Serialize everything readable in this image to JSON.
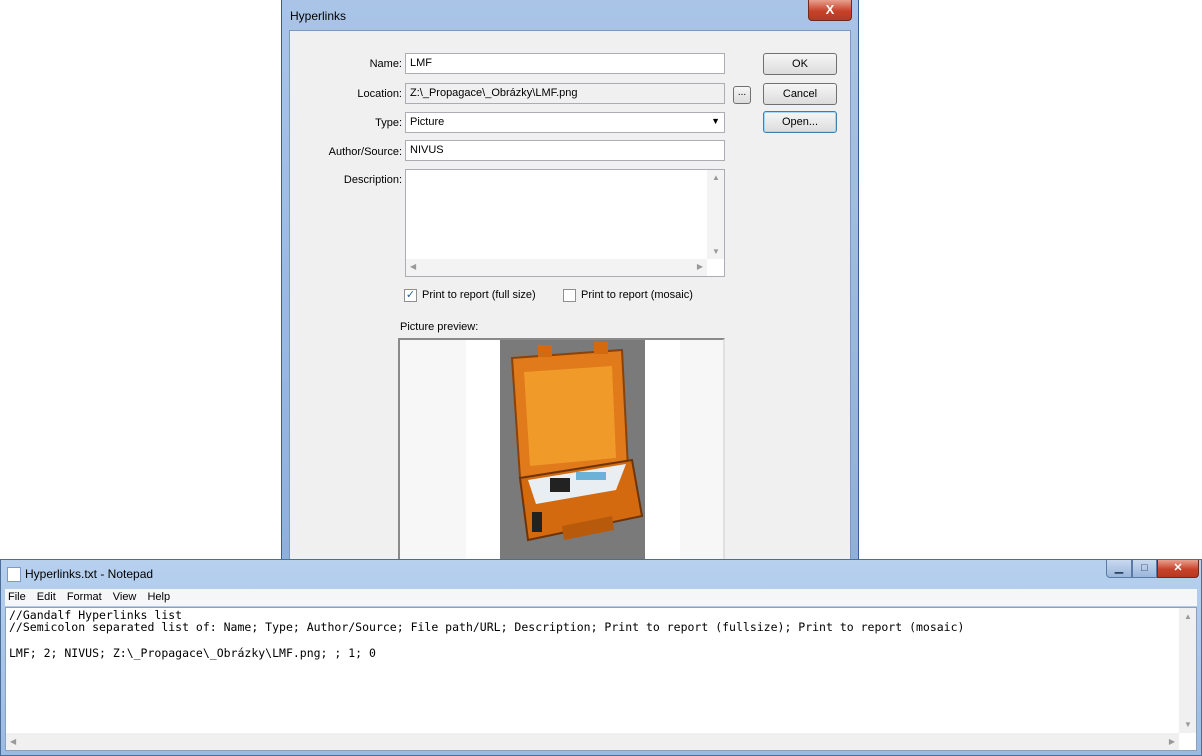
{
  "dialog": {
    "title": "Hyperlinks",
    "close_glyph": "X",
    "name_label": "Name:",
    "name_value": "LMF",
    "location_label": "Location:",
    "location_value": "Z:\\_Propagace\\_Obrázky\\LMF.png",
    "browse_label": "...",
    "type_label": "Type:",
    "type_value": "Picture",
    "author_label": "Author/Source:",
    "author_value": "NIVUS",
    "description_label": "Description:",
    "description_value": "",
    "print_full_label": "Print to report (full size)",
    "print_full_checked": true,
    "print_mosaic_label": "Print to report (mosaic)",
    "print_mosaic_checked": false,
    "preview_label": "Picture preview:",
    "ok_label": "OK",
    "cancel_label": "Cancel",
    "open_label": "Open..."
  },
  "notepad": {
    "title": "Hyperlinks.txt - Notepad",
    "menu": [
      "File",
      "Edit",
      "Format",
      "View",
      "Help"
    ],
    "lines": [
      "//Gandalf Hyperlinks list",
      "//Semicolon separated list of: Name; Type; Author/Source; File path/URL; Description; Print to report (fullsize); Print to report (mosaic)",
      "",
      "LMF; 2; NIVUS; Z:\\_Propagace\\_Obrázky\\LMF.png; ; 1; 0"
    ]
  },
  "colors": {
    "title_bar": "#a9c4e6",
    "close_button": "#c7422b",
    "client_bg": "#f0f0f0"
  }
}
